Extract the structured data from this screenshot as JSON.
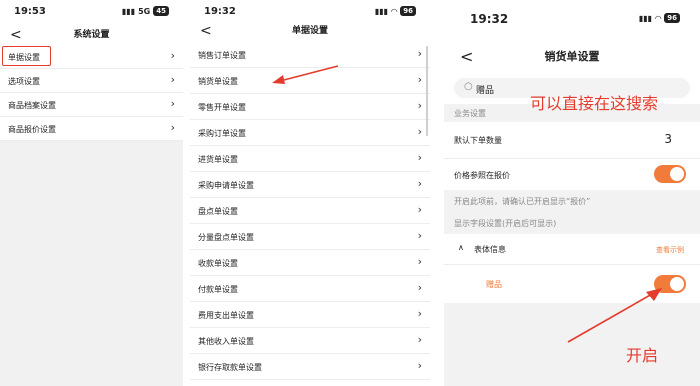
{
  "phone1": {
    "time": "19:53",
    "signal": "5G",
    "battery": "45",
    "back": "<",
    "title": "系统设置",
    "items": [
      {
        "label": "单据设置"
      },
      {
        "label": "选项设置"
      },
      {
        "label": "商品档案设置"
      },
      {
        "label": "商品报价设置"
      }
    ]
  },
  "phone2": {
    "time": "19:32",
    "battery": "96",
    "back": "<",
    "title": "单据设置",
    "items": [
      {
        "label": "销售订单设置"
      },
      {
        "label": "销货单设置"
      },
      {
        "label": "零售开单设置"
      },
      {
        "label": "采购订单设置"
      },
      {
        "label": "进货单设置"
      },
      {
        "label": "采购申请单设置"
      },
      {
        "label": "盘点单设置"
      },
      {
        "label": "分量盘点单设置"
      },
      {
        "label": "收款单设置"
      },
      {
        "label": "付款单设置"
      },
      {
        "label": "费用支出单设置"
      },
      {
        "label": "其他收入单设置"
      },
      {
        "label": "银行存取款单设置"
      }
    ]
  },
  "phone3": {
    "time": "19:32",
    "battery": "96",
    "back": "<",
    "title": "销货单设置",
    "search_value": "赠品",
    "section_business": "业务设置",
    "default_qty_label": "默认下单数量",
    "default_qty_value": "3",
    "price_ref_label": "价格参照在报价",
    "price_ref_enabled": true,
    "hint": "开启此项前，请确认已开启显示“报价”",
    "display_section": "显示字段设置(开启后可显示)",
    "table_info_label": "表体信息",
    "view_example": "查看示例",
    "gift_label": "赠品",
    "gift_enabled": true
  },
  "annotations": {
    "search_hint": "可以直接在这搜索",
    "enable_hint": "开启",
    "color": "#e53b2d"
  },
  "colors": {
    "accent": "#f07b3a",
    "annotation": "#e53b2d",
    "hint_text": "#888888"
  }
}
